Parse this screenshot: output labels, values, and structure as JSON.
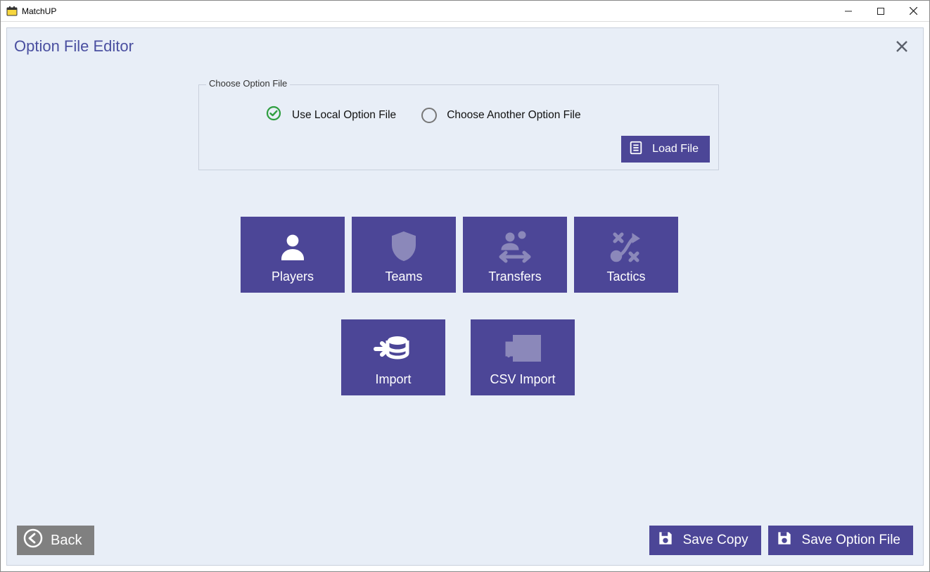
{
  "window": {
    "title": "MatchUP"
  },
  "page": {
    "title": "Option File Editor",
    "choose_group_label": "Choose Option File",
    "radio_local": "Use Local Option File",
    "radio_another": "Choose Another Option File",
    "load_button": "Load File"
  },
  "tiles": {
    "players": "Players",
    "teams": "Teams",
    "transfers": "Transfers",
    "tactics": "Tactics",
    "import": "Import",
    "csv_import": "CSV Import"
  },
  "footer": {
    "back": "Back",
    "save_copy": "Save Copy",
    "save_option": "Save Option File"
  },
  "colors": {
    "accent": "#4c4697"
  }
}
